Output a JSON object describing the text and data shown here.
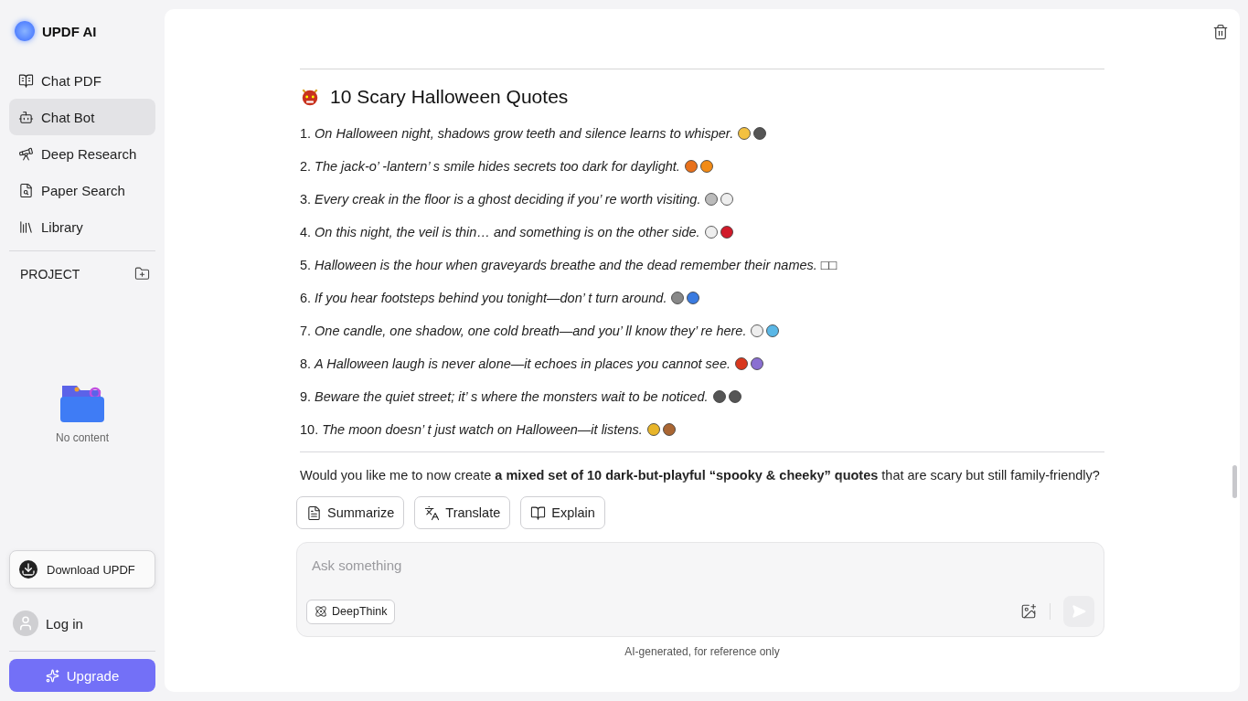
{
  "sidebar": {
    "brand": "UPDF AI",
    "nav": [
      {
        "label": "Chat PDF",
        "selected": false
      },
      {
        "label": "Chat Bot",
        "selected": true
      },
      {
        "label": "Deep Research",
        "selected": false
      },
      {
        "label": "Paper Search",
        "selected": false
      },
      {
        "label": "Library",
        "selected": false
      }
    ],
    "project_label": "PROJECT",
    "empty_text": "No content",
    "download_button": "Download UPDF",
    "login": "Log in",
    "upgrade_button": "Upgrade"
  },
  "chat": {
    "heading": "10 Scary Halloween Quotes",
    "quotes": [
      {
        "number": "1.",
        "text": "On Halloween night, shadows grow teeth and silence learns to whisper."
      },
      {
        "number": "2.",
        "text": "The jack-o’ -lantern’ s smile hides secrets too dark for daylight."
      },
      {
        "number": "3.",
        "text": "Every creak in the floor is a ghost deciding if you’ re worth visiting."
      },
      {
        "number": "4.",
        "text": "On this night, the veil is thin… and something is on the other side."
      },
      {
        "number": "5.",
        "text": "Halloween is the hour when graveyards breathe and the dead remember their names. □□"
      },
      {
        "number": "6.",
        "text": "If you hear footsteps behind you tonight—don’ t turn around."
      },
      {
        "number": "7.",
        "text": "One candle, one shadow, one cold breath—and you’ ll know they’ re here."
      },
      {
        "number": "8.",
        "text": "A Halloween laugh is never alone—it echoes in places you cannot see."
      },
      {
        "number": "9.",
        "text": "Beware the quiet street; it’ s where the monsters wait to be noticed."
      },
      {
        "number": "10.",
        "text": "The moon doesn’ t just watch on Halloween—it listens."
      }
    ],
    "follow_up": "Would you like me to now create **a mixed set of 10 dark-but-playful “spooky & cheeky” quotes** that are scary but still family-friendly?",
    "actions": [
      "Summarize",
      "Translate",
      "Explain"
    ],
    "input_placeholder": "Ask something",
    "deepthink_button": "DeepThink",
    "disclaimer": "AI-generated, for reference only"
  }
}
